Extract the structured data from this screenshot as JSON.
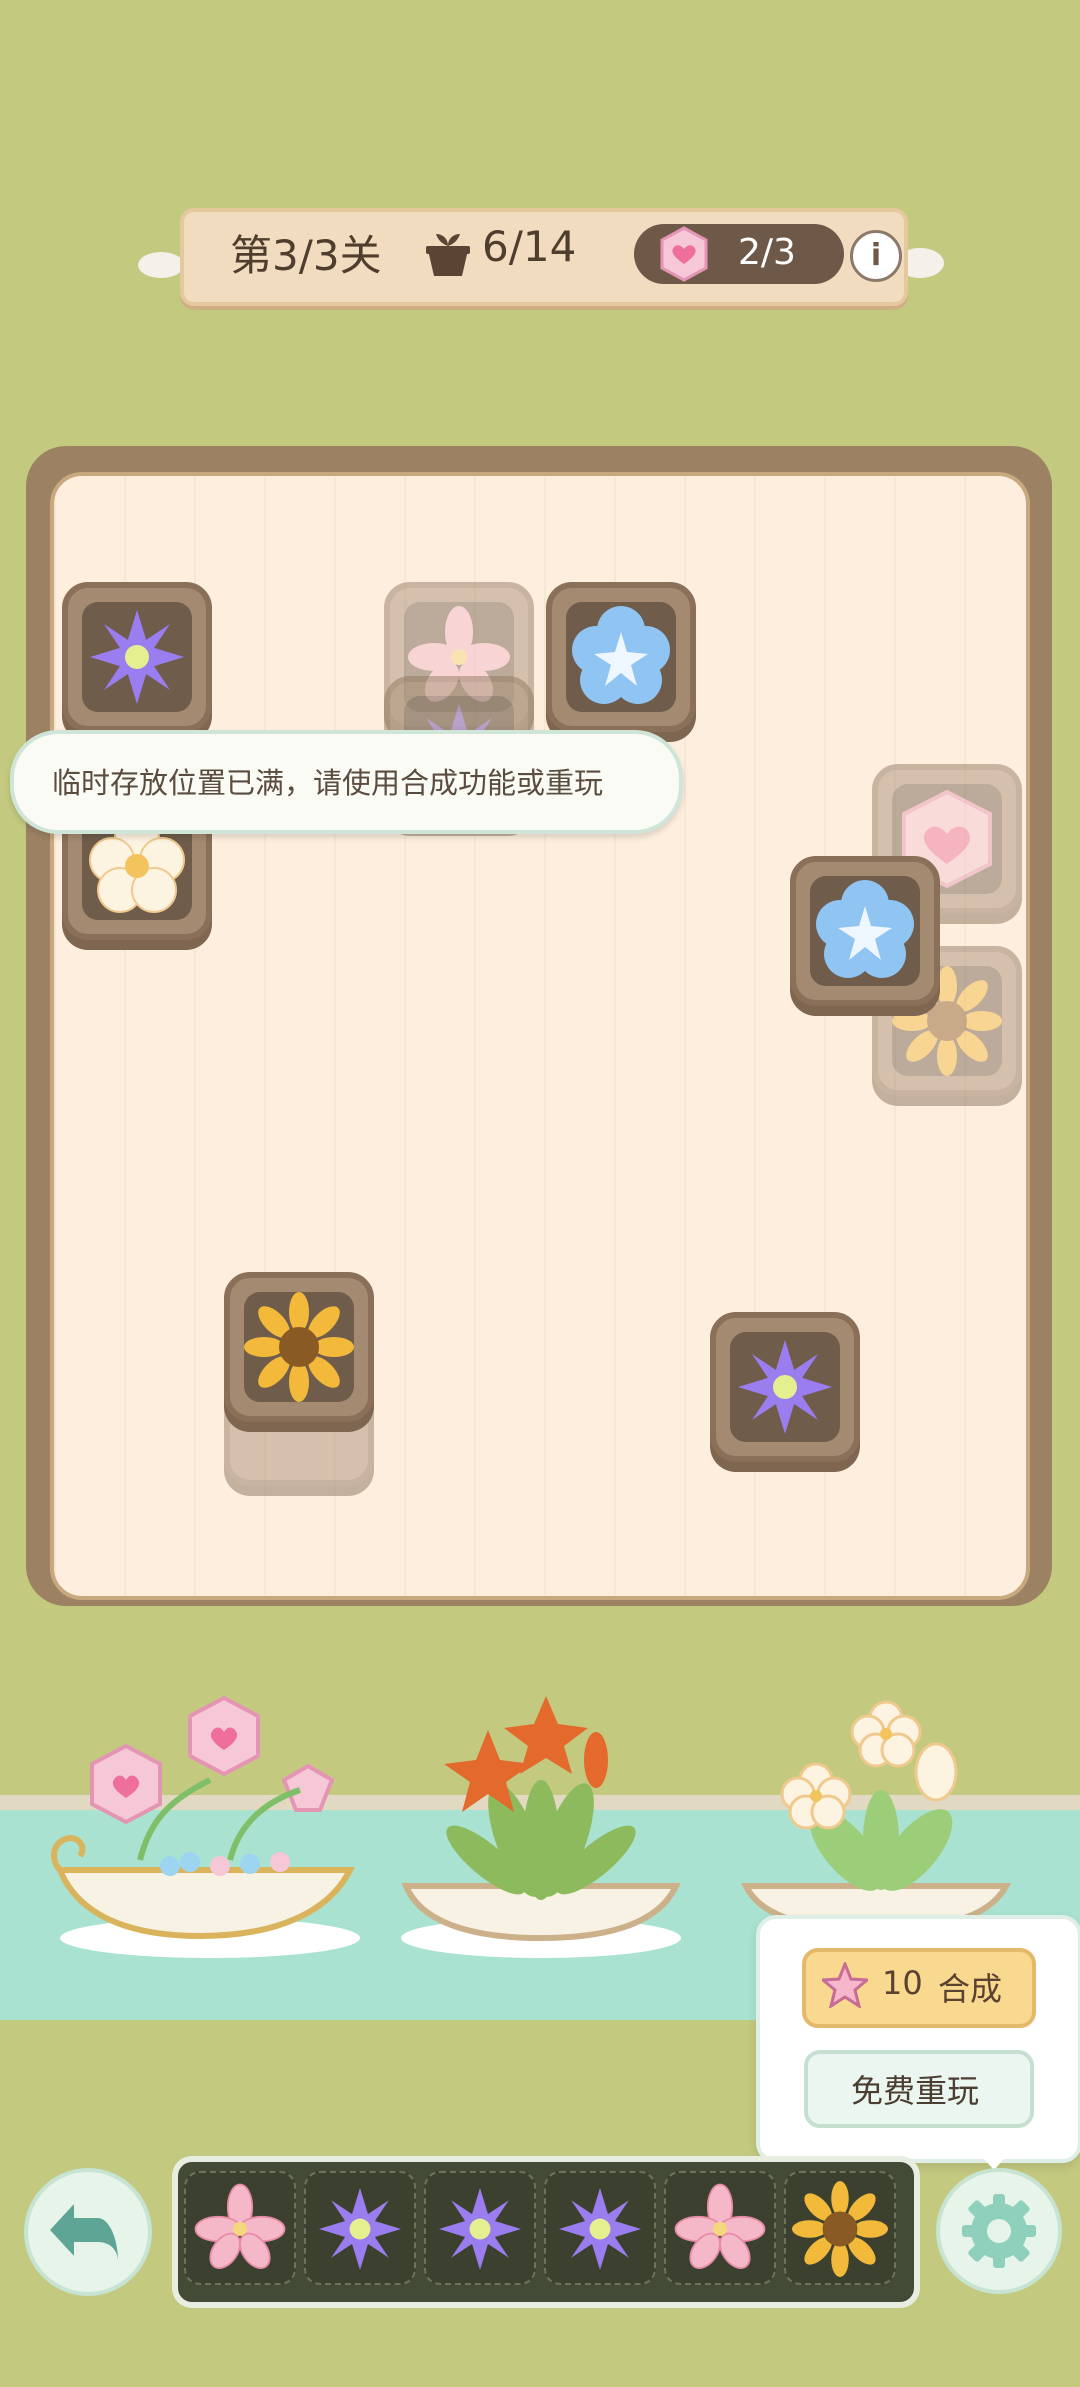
{
  "header": {
    "level_label": "第3/3关",
    "progress_label": "6/14",
    "gem_count": "2/3",
    "info_label": "i"
  },
  "toast": {
    "message": "临时存放位置已满，请使用合成功能或重玩"
  },
  "popup": {
    "merge_cost": "10",
    "merge_label": "合成",
    "replay_label": "免费重玩"
  },
  "board_tiles": [
    {
      "flower": "purple-clematis",
      "dimmed": false
    },
    {
      "flower": "pink-lily",
      "dimmed": true
    },
    {
      "flower": "blue-star-flower",
      "dimmed": false
    },
    {
      "flower": "purple-clematis",
      "dimmed": true
    },
    {
      "flower": "white-plum-blossom",
      "dimmed": false
    },
    {
      "flower": "pink-heart-gem",
      "dimmed": true
    },
    {
      "flower": "blue-star-flower",
      "dimmed": false
    },
    {
      "flower": "sunflower",
      "dimmed": true
    },
    {
      "flower": "sunflower",
      "dimmed": false
    },
    {
      "flower": "purple-clematis",
      "dimmed": false
    }
  ],
  "boats": [
    {
      "cargo": "pink-heart-gem"
    },
    {
      "cargo": "orange-lily"
    },
    {
      "cargo": "white-plum-blossom"
    }
  ],
  "tray_slots": [
    {
      "flower": "pink-lily"
    },
    {
      "flower": "purple-clematis"
    },
    {
      "flower": "purple-clematis"
    },
    {
      "flower": "purple-clematis"
    },
    {
      "flower": "pink-lily"
    },
    {
      "flower": "sunflower"
    }
  ],
  "colors": {
    "background": "#c3c97f",
    "board": "#fdeede",
    "tile_frame": "#8a7058",
    "merge_button": "#f8d98f",
    "tray": "#434a35",
    "river": "#a9e2d1"
  }
}
